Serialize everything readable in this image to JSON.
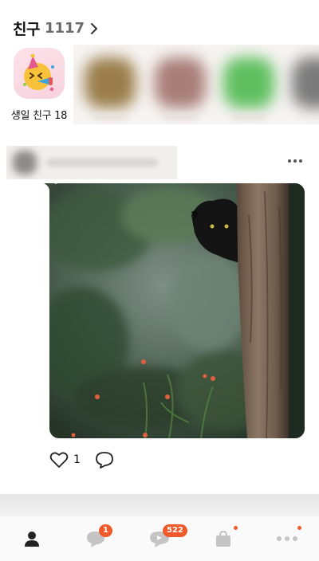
{
  "header": {
    "title": "친구",
    "count": "1117"
  },
  "birthday": {
    "label": "생일 친구 18"
  },
  "feed": {
    "like_count": "1"
  },
  "tabbar": {
    "friends": {
      "label": "friends-tab"
    },
    "chats": {
      "badge": "1"
    },
    "openchat": {
      "badge": "522"
    }
  },
  "colors": {
    "accent": "#f05a2a",
    "text": "#111111",
    "muted": "#6b6b6b"
  },
  "icons": [
    "chevron-right-icon",
    "party-face-icon",
    "more-icon",
    "heart-icon",
    "comment-icon",
    "person-icon",
    "chat-icon",
    "openchat-icon",
    "shopping-bag-icon"
  ]
}
